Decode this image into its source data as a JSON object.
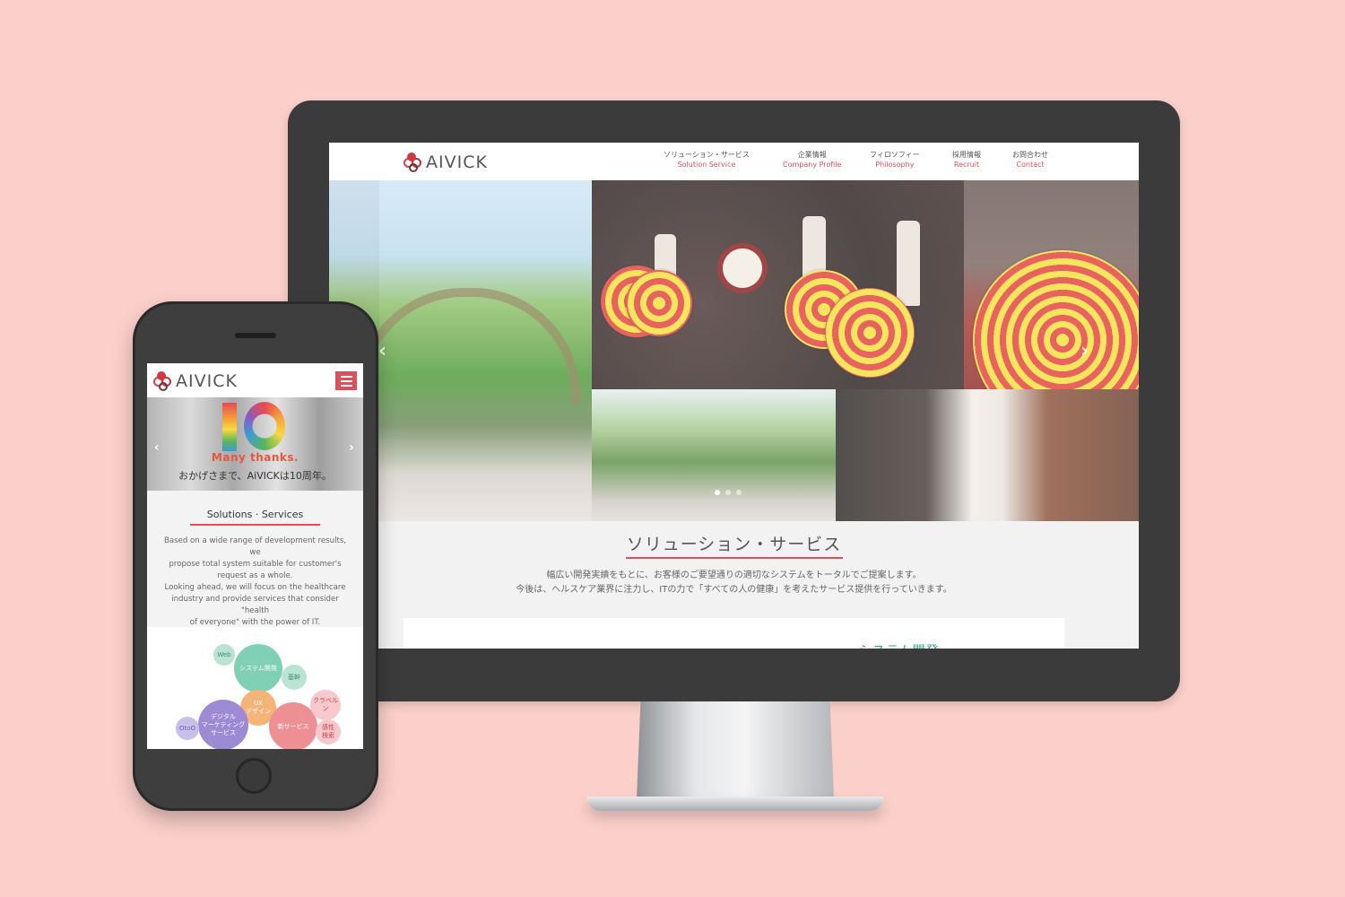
{
  "brand": {
    "name": "AIVICK"
  },
  "desktop": {
    "nav": [
      {
        "jp": "ソリューション・サービス",
        "en": "Solution Service"
      },
      {
        "jp": "企業情報",
        "en": "Company Profile"
      },
      {
        "jp": "フィロソフィー",
        "en": "Philosophy"
      },
      {
        "jp": "採用情報",
        "en": "Recruit"
      },
      {
        "jp": "お問合わせ",
        "en": "Contact"
      }
    ],
    "section_title": "ソリューション・サービス",
    "section_lines": [
      "幅広い開発実績をもとに、お客様のご要望通りの適切なシステムをトータルでご提案します。",
      "今後は、ヘルスケア業界に注力し、ITの力で「すべての人の健康」を考えたサービス提供を行っていきます。"
    ],
    "card_heading": "システム開発",
    "hero_prev": "‹",
    "hero_next": "›"
  },
  "mobile": {
    "hero_number": "10",
    "hero_thanks": "Many thanks.",
    "hero_sub": "おかげさまで、AiVICKは10周年。",
    "section_title": "Solutions · Services",
    "body_lines": [
      "Based on a wide range of development results, we",
      "propose total system suitable for customer's",
      "request as a whole.",
      "Looking ahead, we will focus on the healthcare",
      "industry and provide services that consider \"health",
      "of everyone\" with the power of IT."
    ],
    "bubbles": {
      "web": "Web",
      "system": "システム開発",
      "kiban": "基幹",
      "ux": "UX\nデザイン",
      "digital": "デジタル\nマーケティング\nサービス",
      "new_service": "新サービス",
      "kurabelun": "クラベルン",
      "oto": "OtoO",
      "kansei": "感性\n検索"
    },
    "hero_prev": "‹",
    "hero_next": "›"
  },
  "colors": {
    "background": "#fbcfca",
    "accent": "#d9525a",
    "teal": "#2aa88a"
  }
}
